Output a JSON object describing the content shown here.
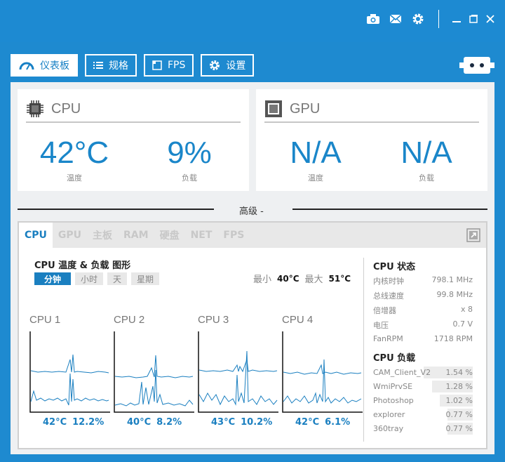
{
  "nav": {
    "dashboard": "仪表板",
    "specs": "规格",
    "fps": "FPS",
    "settings": "设置"
  },
  "cpu_card": {
    "title": "CPU",
    "temp": "42°C",
    "temp_label": "温度",
    "load": "9%",
    "load_label": "负载"
  },
  "gpu_card": {
    "title": "GPU",
    "temp": "N/A",
    "temp_label": "温度",
    "load": "N/A",
    "load_label": "负载"
  },
  "advanced_label": "高级 -",
  "tabs": [
    "CPU",
    "GPU",
    "主板",
    "RAM",
    "硬盘",
    "NET",
    "FPS"
  ],
  "graph_section": {
    "title": "CPU 温度 & 负载 图形",
    "ranges": [
      "分钟",
      "小时",
      "天",
      "星期"
    ],
    "min_label": "最小",
    "min_value": "40°C",
    "max_label": "最大",
    "max_value": "51°C"
  },
  "cores": [
    {
      "name": "CPU 1",
      "temp": "42°C",
      "load": "12.2%"
    },
    {
      "name": "CPU 2",
      "temp": "40°C",
      "load": "8.2%"
    },
    {
      "name": "CPU 3",
      "temp": "43°C",
      "load": "10.2%"
    },
    {
      "name": "CPU 4",
      "temp": "42°C",
      "load": "6.1%"
    }
  ],
  "cpu_status": {
    "title": "CPU 状态",
    "rows": [
      {
        "key": "内核时钟",
        "value": "798.1 MHz"
      },
      {
        "key": "总线速度",
        "value": "99.8 MHz"
      },
      {
        "key": "倍增器",
        "value": "x 8"
      },
      {
        "key": "电压",
        "value": "0.7 V"
      },
      {
        "key": "FanRPM",
        "value": "1718 RPM"
      }
    ]
  },
  "cpu_load": {
    "title": "CPU 负载",
    "processes": [
      {
        "name": "CAM_Client_V2",
        "value": "1.54 %",
        "fraction": 0.49
      },
      {
        "name": "WmiPrvSE",
        "value": "1.28 %",
        "fraction": 0.41
      },
      {
        "name": "Photoshop",
        "value": "1.02 %",
        "fraction": 0.33
      },
      {
        "name": "explorer",
        "value": "0.77 %",
        "fraction": 0.25
      },
      {
        "name": "360tray",
        "value": "0.77 %",
        "fraction": 0.25
      }
    ]
  }
}
